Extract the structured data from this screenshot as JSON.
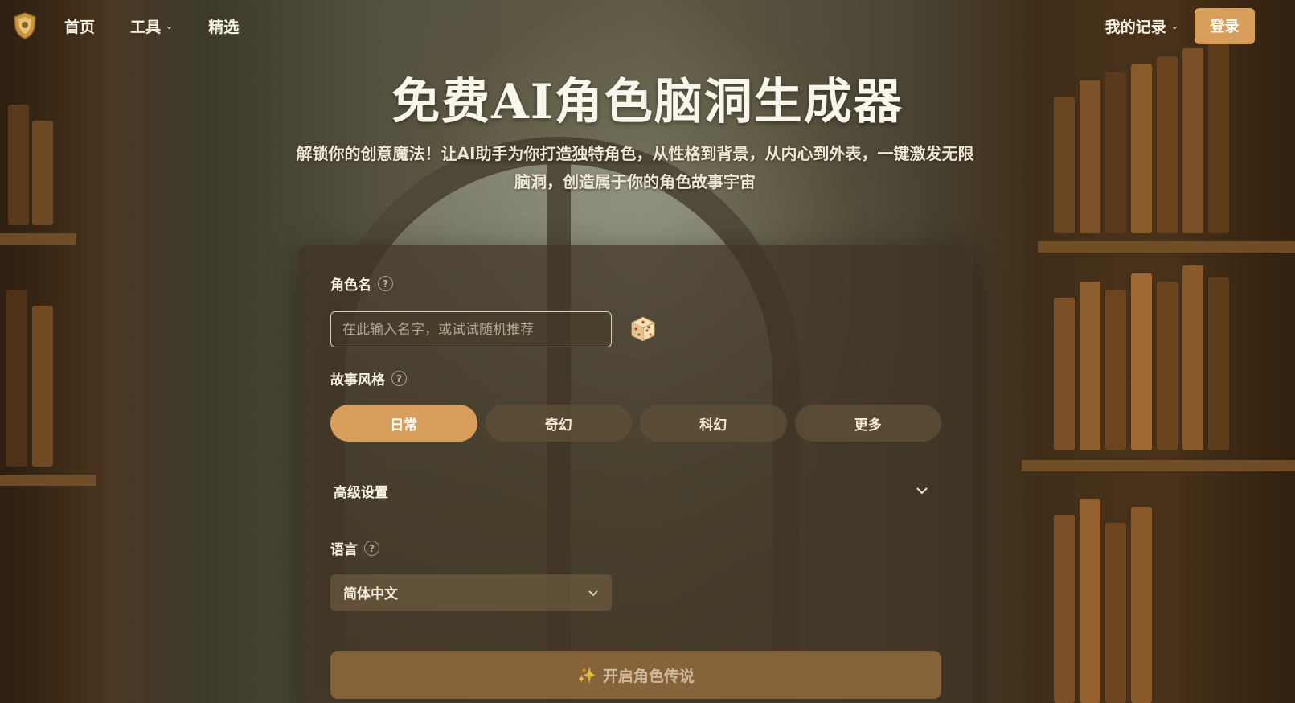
{
  "nav": {
    "home": "首页",
    "tools": "工具",
    "featured": "精选",
    "records": "我的记录",
    "login": "登录"
  },
  "hero": {
    "title": "免费AI角色脑洞生成器",
    "subtitle_line1": "解锁你的创意魔法！让AI助手为你打造独特角色，从性格到背景，从内心到外表，一键激发无限",
    "subtitle_line2": "脑洞，创造属于你的角色故事宇宙"
  },
  "form": {
    "name_label": "角色名",
    "name_placeholder": "在此输入名字，或试试随机推荐",
    "name_value": "",
    "style_label": "故事风格",
    "styles": [
      "日常",
      "奇幻",
      "科幻",
      "更多"
    ],
    "selected_style": "日常",
    "advanced_label": "高级设置",
    "language_label": "语言",
    "language_value": "简体中文",
    "submit_icon": "✨",
    "submit_label": "开启角色传说"
  },
  "colors": {
    "accent": "#d89e5c",
    "card_bg": "rgba(62,50,34,0.72)"
  },
  "icons": {
    "logo": "shield-logo-icon",
    "dice": "dice-icon",
    "help": "question-circle-icon",
    "chevron": "chevron-down-icon"
  }
}
